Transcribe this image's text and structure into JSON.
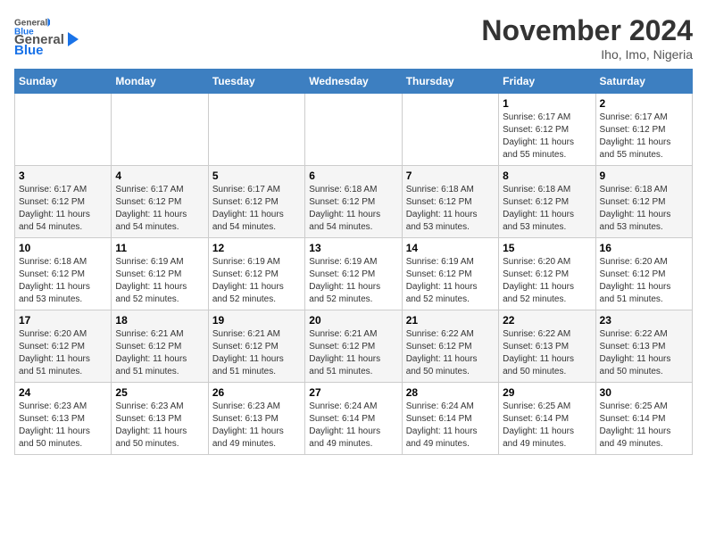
{
  "header": {
    "logo_general": "General",
    "logo_blue": "Blue",
    "month_title": "November 2024",
    "location": "Iho, Imo, Nigeria"
  },
  "days_of_week": [
    "Sunday",
    "Monday",
    "Tuesday",
    "Wednesday",
    "Thursday",
    "Friday",
    "Saturday"
  ],
  "weeks": [
    [
      {
        "day": "",
        "detail": ""
      },
      {
        "day": "",
        "detail": ""
      },
      {
        "day": "",
        "detail": ""
      },
      {
        "day": "",
        "detail": ""
      },
      {
        "day": "",
        "detail": ""
      },
      {
        "day": "1",
        "detail": "Sunrise: 6:17 AM\nSunset: 6:12 PM\nDaylight: 11 hours\nand 55 minutes."
      },
      {
        "day": "2",
        "detail": "Sunrise: 6:17 AM\nSunset: 6:12 PM\nDaylight: 11 hours\nand 55 minutes."
      }
    ],
    [
      {
        "day": "3",
        "detail": "Sunrise: 6:17 AM\nSunset: 6:12 PM\nDaylight: 11 hours\nand 54 minutes."
      },
      {
        "day": "4",
        "detail": "Sunrise: 6:17 AM\nSunset: 6:12 PM\nDaylight: 11 hours\nand 54 minutes."
      },
      {
        "day": "5",
        "detail": "Sunrise: 6:17 AM\nSunset: 6:12 PM\nDaylight: 11 hours\nand 54 minutes."
      },
      {
        "day": "6",
        "detail": "Sunrise: 6:18 AM\nSunset: 6:12 PM\nDaylight: 11 hours\nand 54 minutes."
      },
      {
        "day": "7",
        "detail": "Sunrise: 6:18 AM\nSunset: 6:12 PM\nDaylight: 11 hours\nand 53 minutes."
      },
      {
        "day": "8",
        "detail": "Sunrise: 6:18 AM\nSunset: 6:12 PM\nDaylight: 11 hours\nand 53 minutes."
      },
      {
        "day": "9",
        "detail": "Sunrise: 6:18 AM\nSunset: 6:12 PM\nDaylight: 11 hours\nand 53 minutes."
      }
    ],
    [
      {
        "day": "10",
        "detail": "Sunrise: 6:18 AM\nSunset: 6:12 PM\nDaylight: 11 hours\nand 53 minutes."
      },
      {
        "day": "11",
        "detail": "Sunrise: 6:19 AM\nSunset: 6:12 PM\nDaylight: 11 hours\nand 52 minutes."
      },
      {
        "day": "12",
        "detail": "Sunrise: 6:19 AM\nSunset: 6:12 PM\nDaylight: 11 hours\nand 52 minutes."
      },
      {
        "day": "13",
        "detail": "Sunrise: 6:19 AM\nSunset: 6:12 PM\nDaylight: 11 hours\nand 52 minutes."
      },
      {
        "day": "14",
        "detail": "Sunrise: 6:19 AM\nSunset: 6:12 PM\nDaylight: 11 hours\nand 52 minutes."
      },
      {
        "day": "15",
        "detail": "Sunrise: 6:20 AM\nSunset: 6:12 PM\nDaylight: 11 hours\nand 52 minutes."
      },
      {
        "day": "16",
        "detail": "Sunrise: 6:20 AM\nSunset: 6:12 PM\nDaylight: 11 hours\nand 51 minutes."
      }
    ],
    [
      {
        "day": "17",
        "detail": "Sunrise: 6:20 AM\nSunset: 6:12 PM\nDaylight: 11 hours\nand 51 minutes."
      },
      {
        "day": "18",
        "detail": "Sunrise: 6:21 AM\nSunset: 6:12 PM\nDaylight: 11 hours\nand 51 minutes."
      },
      {
        "day": "19",
        "detail": "Sunrise: 6:21 AM\nSunset: 6:12 PM\nDaylight: 11 hours\nand 51 minutes."
      },
      {
        "day": "20",
        "detail": "Sunrise: 6:21 AM\nSunset: 6:12 PM\nDaylight: 11 hours\nand 51 minutes."
      },
      {
        "day": "21",
        "detail": "Sunrise: 6:22 AM\nSunset: 6:12 PM\nDaylight: 11 hours\nand 50 minutes."
      },
      {
        "day": "22",
        "detail": "Sunrise: 6:22 AM\nSunset: 6:13 PM\nDaylight: 11 hours\nand 50 minutes."
      },
      {
        "day": "23",
        "detail": "Sunrise: 6:22 AM\nSunset: 6:13 PM\nDaylight: 11 hours\nand 50 minutes."
      }
    ],
    [
      {
        "day": "24",
        "detail": "Sunrise: 6:23 AM\nSunset: 6:13 PM\nDaylight: 11 hours\nand 50 minutes."
      },
      {
        "day": "25",
        "detail": "Sunrise: 6:23 AM\nSunset: 6:13 PM\nDaylight: 11 hours\nand 50 minutes."
      },
      {
        "day": "26",
        "detail": "Sunrise: 6:23 AM\nSunset: 6:13 PM\nDaylight: 11 hours\nand 49 minutes."
      },
      {
        "day": "27",
        "detail": "Sunrise: 6:24 AM\nSunset: 6:14 PM\nDaylight: 11 hours\nand 49 minutes."
      },
      {
        "day": "28",
        "detail": "Sunrise: 6:24 AM\nSunset: 6:14 PM\nDaylight: 11 hours\nand 49 minutes."
      },
      {
        "day": "29",
        "detail": "Sunrise: 6:25 AM\nSunset: 6:14 PM\nDaylight: 11 hours\nand 49 minutes."
      },
      {
        "day": "30",
        "detail": "Sunrise: 6:25 AM\nSunset: 6:14 PM\nDaylight: 11 hours\nand 49 minutes."
      }
    ]
  ]
}
